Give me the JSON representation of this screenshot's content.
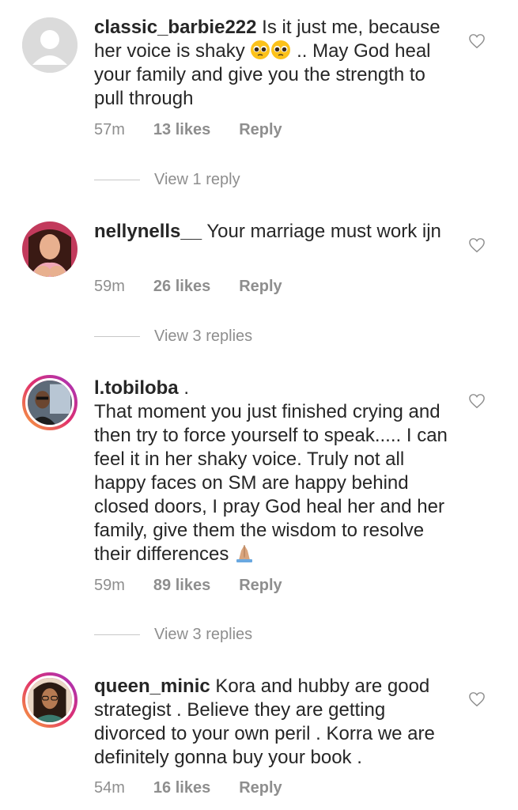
{
  "comments": [
    {
      "username": "classic_barbie222",
      "text_before": " Is it just me, because her voice is shaky ",
      "text_after": " .. May God heal your family and give you the strength to pull through",
      "time": "57m",
      "likes": "13 likes",
      "reply": "Reply",
      "view_replies": "View 1 reply",
      "avatar": "default-avatar-icon"
    },
    {
      "username": "nellynells__",
      "text": " Your marriage must work ijn",
      "time": "59m",
      "likes": "26 likes",
      "reply": "Reply",
      "view_replies": "View 3 replies",
      "avatar": "user-photo"
    },
    {
      "username": "l.tobiloba",
      "username_suffix": " .",
      "text": "That moment you just finished crying and then try to force yourself to speak..... I can feel it in her shaky voice. Truly not all happy faces on SM are happy behind closed doors, I pray God heal her and her family, give them the wisdom to resolve their differences",
      "time": "59m",
      "likes": "89 likes",
      "reply": "Reply",
      "view_replies": "View 3 replies",
      "avatar": "user-photo-story-ring"
    },
    {
      "username": "queen_minic",
      "text": " Kora and hubby are good strategist . Believe they are getting divorced to your own peril . Korra we are definitely gonna buy your book .",
      "time": "54m",
      "likes": "16 likes",
      "reply": "Reply",
      "avatar": "user-photo-story-ring"
    }
  ],
  "icons": {
    "like": "heart-outline-icon",
    "pleading_face": "pleading-face-emoji",
    "praying_hands": "folded-hands-emoji"
  },
  "colors": {
    "text": "#262626",
    "secondary": "#8e8e8e",
    "divider": "#c7c7c7"
  }
}
